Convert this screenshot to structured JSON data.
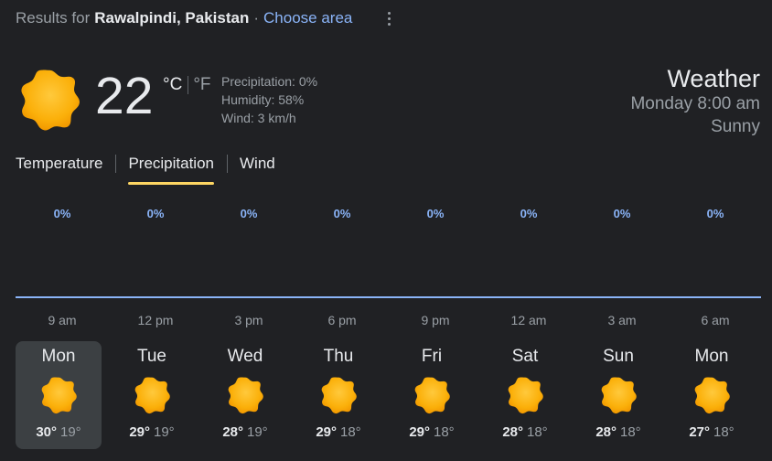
{
  "header": {
    "results_prefix": "Results for",
    "location": "Rawalpindi, Pakistan",
    "separator": "·",
    "choose_area": "Choose area",
    "more_icon": "more-vert-icon"
  },
  "current": {
    "icon": "sun-icon",
    "temperature": "22",
    "unit_c": "°C",
    "unit_f": "°F",
    "precipitation": "Precipitation: 0%",
    "humidity": "Humidity: 58%",
    "wind": "Wind: 3 km/h"
  },
  "summary": {
    "title": "Weather",
    "datetime": "Monday 8:00 am",
    "condition": "Sunny"
  },
  "tabs": [
    "Temperature",
    "Precipitation",
    "Wind"
  ],
  "active_tab": "Precipitation",
  "precipitation": [
    "0%",
    "0%",
    "0%",
    "0%",
    "0%",
    "0%",
    "0%",
    "0%"
  ],
  "times": [
    "9 am",
    "12 pm",
    "3 pm",
    "6 pm",
    "9 pm",
    "12 am",
    "3 am",
    "6 am"
  ],
  "forecast": [
    {
      "day": "Mon",
      "high": "30°",
      "low": "19°"
    },
    {
      "day": "Tue",
      "high": "29°",
      "low": "19°"
    },
    {
      "day": "Wed",
      "high": "28°",
      "low": "19°"
    },
    {
      "day": "Thu",
      "high": "29°",
      "low": "18°"
    },
    {
      "day": "Fri",
      "high": "29°",
      "low": "18°"
    },
    {
      "day": "Sat",
      "high": "28°",
      "low": "18°"
    },
    {
      "day": "Sun",
      "high": "28°",
      "low": "18°"
    },
    {
      "day": "Mon",
      "high": "27°",
      "low": "18°"
    }
  ],
  "colors": {
    "background": "#202124",
    "accent_blue": "#8ab4f8",
    "tab_underline": "#fdd663",
    "sun_outer": "#fbbc04",
    "sun_inner": "#f29900",
    "selected_day_bg": "#3c4043"
  }
}
